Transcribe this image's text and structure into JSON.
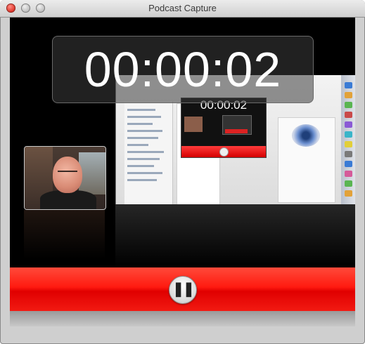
{
  "window": {
    "title": "Podcast Capture"
  },
  "recording": {
    "elapsed": "00:00:02",
    "preview_elapsed": "00:00:02",
    "pause_glyph": "❚❚"
  },
  "colors": {
    "control_bar": "#ff1a10",
    "stage": "#000000"
  },
  "icons": [
    "close-icon",
    "minimize-icon",
    "zoom-icon",
    "pause-icon"
  ]
}
